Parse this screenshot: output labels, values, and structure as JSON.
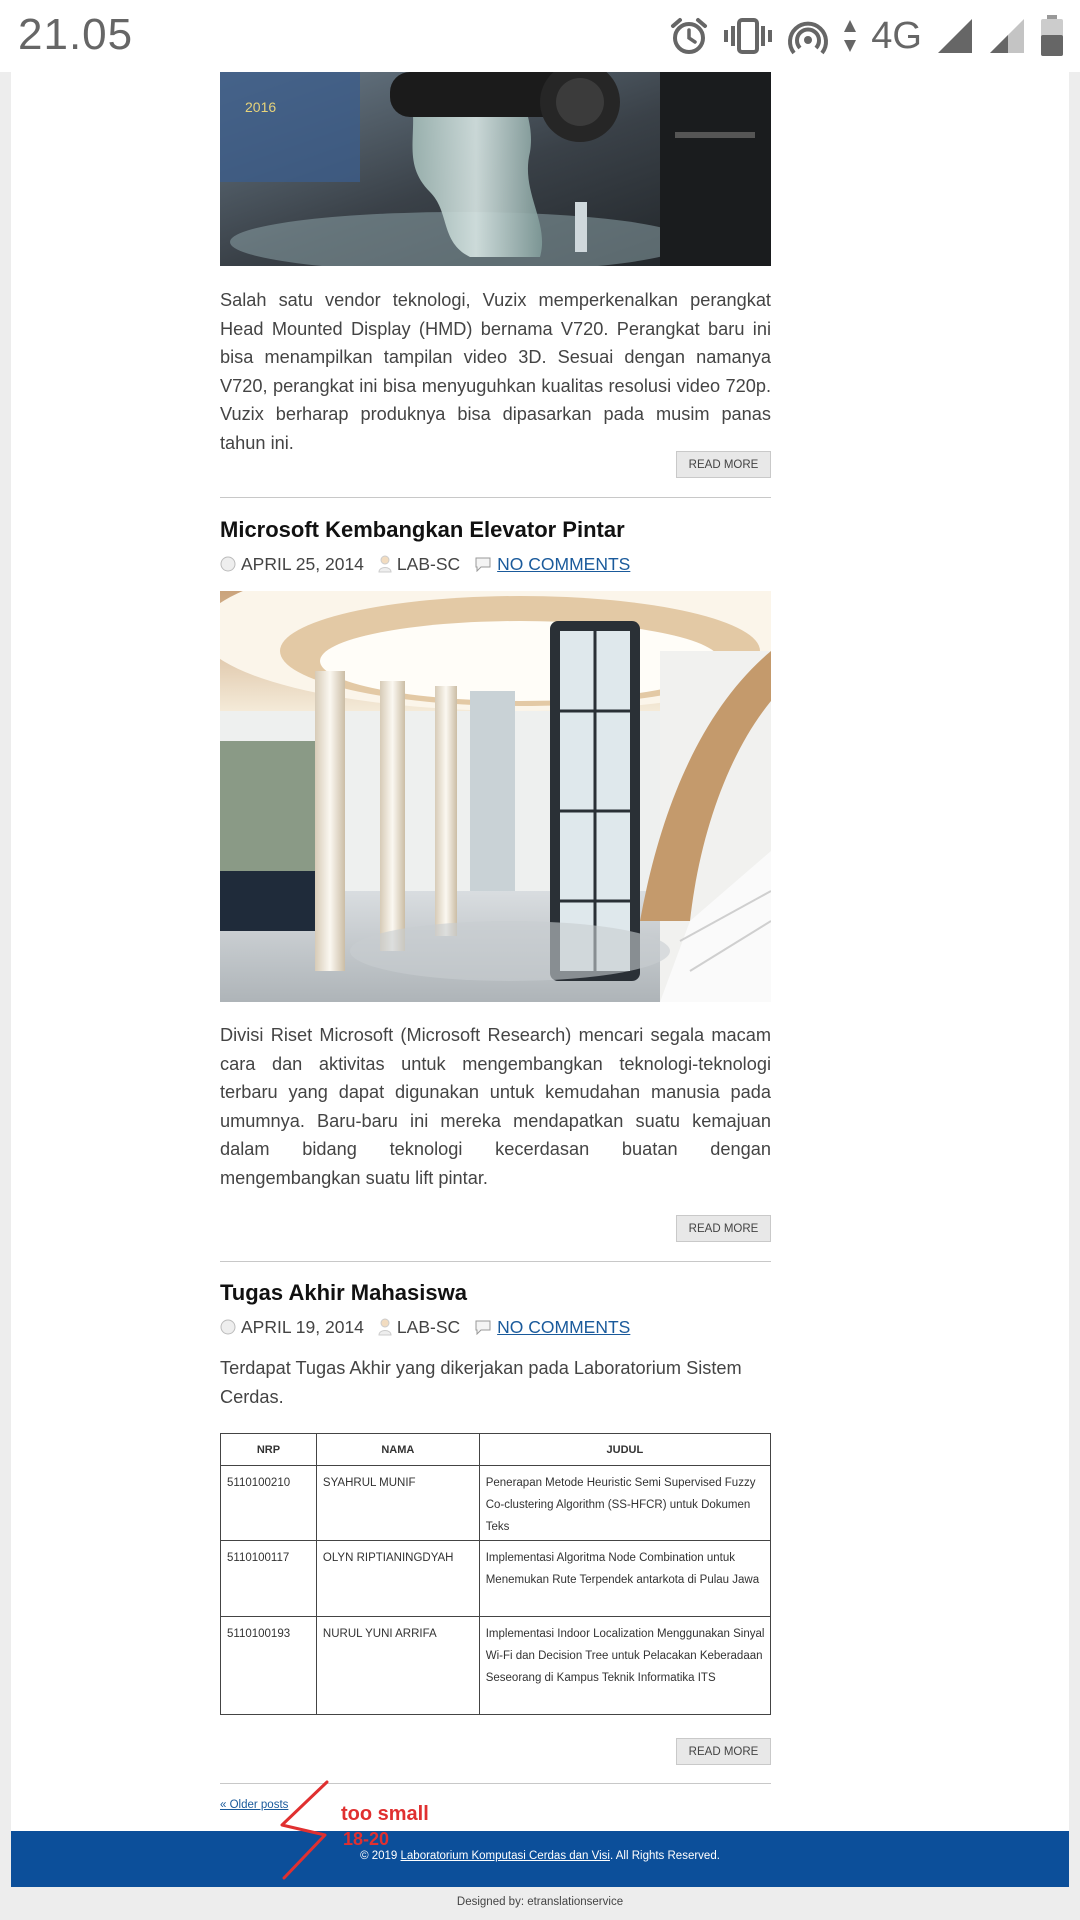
{
  "status_bar": {
    "time": "21.05",
    "network": "4G",
    "icons": [
      "alarm-icon",
      "vibrate-icon",
      "hotspot-icon",
      "data-arrows-icon",
      "signal-icon",
      "signal-weak-icon",
      "battery-icon"
    ]
  },
  "posts": [
    {
      "excerpt": "Salah satu vendor teknologi, Vuzix memperkenalkan perangkat Head Mounted Display (HMD) bernama V720. Perangkat baru ini bisa menampilkan tampilan video 3D. Sesuai dengan namanya V720, perangkat ini bisa menyuguhkan kualitas resolusi video 720p. Vuzix berharap produknya bisa dipasarkan pada musim panas tahun ini.",
      "read_more": "READ MORE"
    },
    {
      "title": "Microsoft Kembangkan Elevator Pintar",
      "date": "APRIL 25, 2014",
      "author": "LAB-SC",
      "comments": "NO COMMENTS",
      "excerpt": "Divisi Riset Microsoft (Microsoft Research) mencari segala macam cara dan aktivitas untuk mengembangkan teknologi-teknologi terbaru yang dapat digunakan untuk kemudahan manusia pada umumnya. Baru-baru ini mereka mendapatkan suatu kemajuan dalam bidang teknologi kecerdasan buatan dengan mengembangkan suatu lift pintar.",
      "read_more": "READ MORE"
    },
    {
      "title": "Tugas Akhir Mahasiswa",
      "date": "APRIL 19, 2014",
      "author": "LAB-SC",
      "comments": "NO COMMENTS",
      "intro": "Terdapat Tugas Akhir yang dikerjakan pada Laboratorium Sistem Cerdas.",
      "read_more": "READ MORE",
      "table": {
        "headers": [
          "NRP",
          "NAMA",
          "JUDUL"
        ],
        "rows": [
          [
            "5110100210",
            "SYAHRUL MUNIF",
            "Penerapan Metode Heuristic Semi Supervised Fuzzy Co-clustering Algorithm (SS-HFCR) untuk Dokumen Teks"
          ],
          [
            "5110100117",
            "OLYN RIPTIANINGDYAH",
            "Implementasi Algoritma Node Combination untuk Menemukan Rute Terpendek antarkota di Pulau Jawa"
          ],
          [
            "5110100193",
            "NURUL YUNI ARRIFA",
            "Implementasi Indoor Localization Menggunakan Sinyal Wi-Fi dan Decision Tree untuk Pelacakan Keberadaan Seseorang di Kampus Teknik Informatika ITS"
          ]
        ]
      }
    }
  ],
  "pagination": {
    "older": "« Older posts"
  },
  "footer": {
    "copyright_prefix": "© 2019 ",
    "copyright_link": "Laboratorium Komputasi Cerdas dan Visi",
    "copyright_suffix": ". All Rights Reserved.",
    "designed_by": "Designed by: etranslationservice"
  },
  "annotation": {
    "note": "too small",
    "range": "18-20",
    "color": "#e03030"
  },
  "colors": {
    "footer_bar": "#0c4f9a",
    "link": "#1a5a9b"
  }
}
